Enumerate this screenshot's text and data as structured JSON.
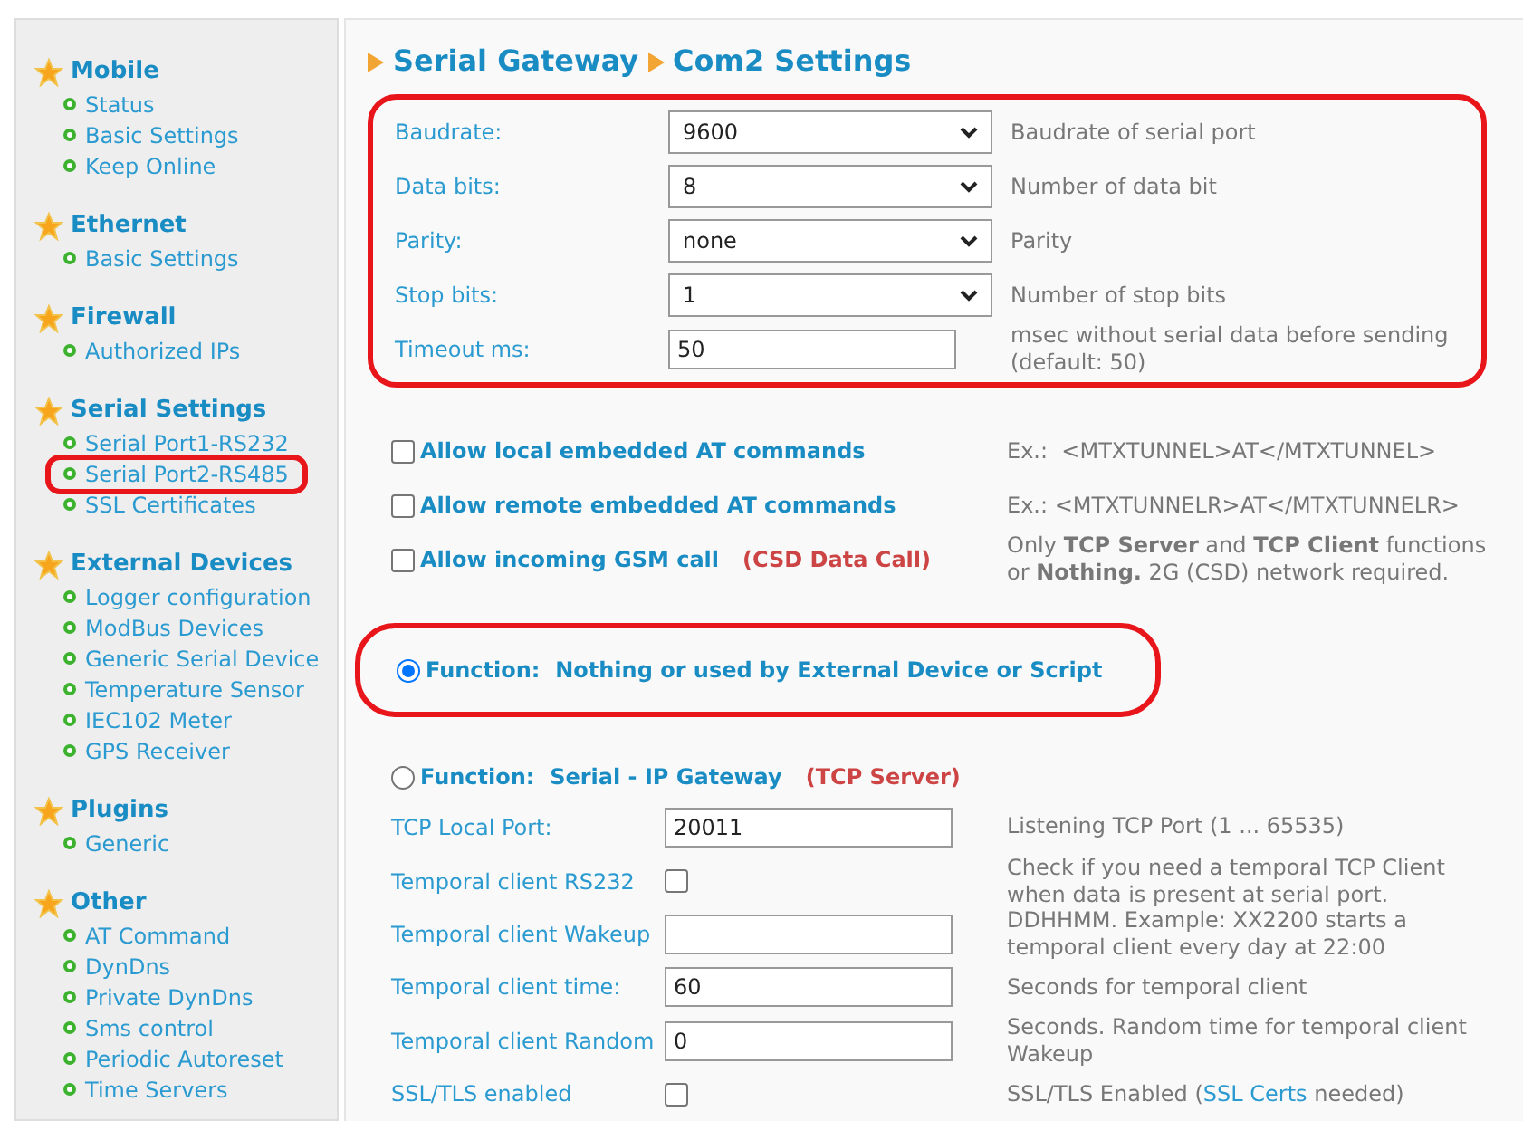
{
  "sidebar": {
    "groups": [
      {
        "title": "Mobile",
        "items": [
          {
            "label": "Status",
            "circled": false
          },
          {
            "label": "Basic Settings",
            "circled": false
          },
          {
            "label": "Keep Online",
            "circled": false
          }
        ]
      },
      {
        "title": "Ethernet",
        "items": [
          {
            "label": "Basic Settings",
            "circled": false
          }
        ]
      },
      {
        "title": "Firewall",
        "items": [
          {
            "label": "Authorized IPs",
            "circled": false
          }
        ]
      },
      {
        "title": "Serial Settings",
        "items": [
          {
            "label": "Serial Port1-RS232",
            "circled": false
          },
          {
            "label": "Serial Port2-RS485",
            "circled": true
          },
          {
            "label": "SSL Certificates",
            "circled": false
          }
        ]
      },
      {
        "title": "External Devices",
        "items": [
          {
            "label": "Logger configuration",
            "circled": false
          },
          {
            "label": "ModBus Devices",
            "circled": false
          },
          {
            "label": "Generic Serial Device",
            "circled": false
          },
          {
            "label": "Temperature Sensor",
            "circled": false
          },
          {
            "label": "IEC102 Meter",
            "circled": false
          },
          {
            "label": "GPS Receiver",
            "circled": false
          }
        ]
      },
      {
        "title": "Plugins",
        "items": [
          {
            "label": "Generic",
            "circled": false
          }
        ]
      },
      {
        "title": "Other",
        "items": [
          {
            "label": "AT Command",
            "circled": false
          },
          {
            "label": "DynDns",
            "circled": false
          },
          {
            "label": "Private DynDns",
            "circled": false
          },
          {
            "label": "Sms control",
            "circled": false
          },
          {
            "label": "Periodic Autoreset",
            "circled": false
          },
          {
            "label": "Time Servers",
            "circled": false
          }
        ]
      }
    ]
  },
  "breadcrumb": [
    "Serial Gateway",
    "Com2 Settings"
  ],
  "port_settings": {
    "circled": true,
    "rows": [
      {
        "kind": "select",
        "label": "Baudrate:",
        "value": "9600",
        "description": "Baudrate of serial port"
      },
      {
        "kind": "select",
        "label": "Data bits:",
        "value": "8",
        "description": "Number of data bit"
      },
      {
        "kind": "select",
        "label": "Parity:",
        "value": "none",
        "description": "Parity"
      },
      {
        "kind": "select",
        "label": "Stop bits:",
        "value": "1",
        "description": "Number of stop bits"
      },
      {
        "kind": "input",
        "label": "Timeout ms:",
        "value": "50",
        "description": "msec without serial data before sending (default: 50)"
      }
    ]
  },
  "options": [
    {
      "label": "Allow local embedded AT commands",
      "checked": false,
      "description": "Ex.:  <MTXTUNNEL>AT</MTXTUNNEL>"
    },
    {
      "label": "Allow remote embedded AT commands",
      "checked": false,
      "description": "Ex.: <MTXTUNNELR>AT</MTXTUNNELR>"
    },
    {
      "label": "Allow incoming GSM call",
      "tag": "(CSD Data Call)",
      "checked": false,
      "description": "Only **TCP Server** and **TCP Client** functions or **Nothing.** 2G (CSD) network required."
    }
  ],
  "functions": [
    {
      "label": "Function:  Nothing or used by External Device or Script",
      "selected": true,
      "circled": true
    },
    {
      "label": "Function:  Serial - IP Gateway",
      "tag": "(TCP Server)",
      "selected": false,
      "circled": false,
      "rows": [
        {
          "kind": "input",
          "label": "TCP Local Port:",
          "value": "20011",
          "description": "Listening TCP Port (1 ... 65535)"
        },
        {
          "kind": "checkbox",
          "label": "Temporal client RS232",
          "checked": false,
          "description": "Check if you need a temporal TCP Client when data is present at serial port."
        },
        {
          "kind": "input",
          "label": "Temporal client Wakeup",
          "value": "",
          "description": "DDHHMM. Example: XX2200 starts a temporal client every day at 22:00"
        },
        {
          "kind": "input",
          "label": "Temporal client time:",
          "value": "60",
          "description": "Seconds for temporal client"
        },
        {
          "kind": "input",
          "label": "Temporal client Random",
          "value": "0",
          "description": "Seconds. Random time for temporal client Wakeup"
        },
        {
          "kind": "checkbox",
          "label": "SSL/TLS enabled",
          "checked": false,
          "description": "SSL/TLS Enabled (",
          "link": "SSL Certs",
          "description_end": " needed)"
        }
      ]
    }
  ]
}
